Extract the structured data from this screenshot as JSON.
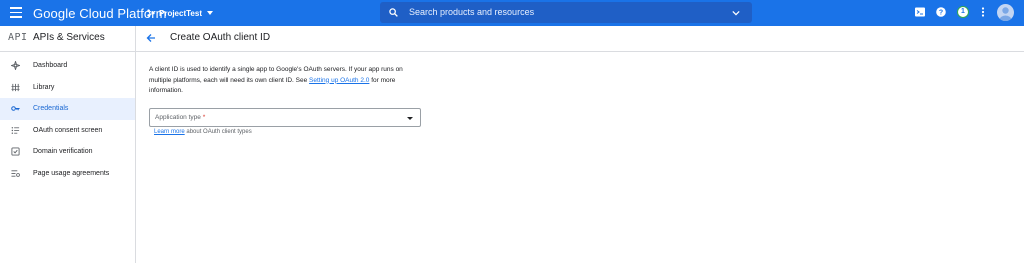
{
  "topbar": {
    "brand": "Google Cloud Platform",
    "project": "ProjectTest",
    "search_placeholder": "Search products and resources",
    "notification_count": "1",
    "color": "#1a73e8"
  },
  "subheader": {
    "api_logo": "API",
    "api_title": "APIs & Services",
    "page_title": "Create OAuth client ID"
  },
  "sidebar": {
    "items": [
      {
        "label": "Dashboard",
        "icon": "dashboard-icon"
      },
      {
        "label": "Library",
        "icon": "library-icon"
      },
      {
        "label": "Credentials",
        "icon": "key-icon"
      },
      {
        "label": "OAuth consent screen",
        "icon": "consent-icon"
      },
      {
        "label": "Domain verification",
        "icon": "checkbox-icon"
      },
      {
        "label": "Page usage agreements",
        "icon": "settings-list-icon"
      }
    ],
    "active_index": 2
  },
  "content": {
    "desc_prefix": "A client ID is used to identify a single app to Google's OAuth servers. If your app runs on multiple platforms, each will need its own client ID. See ",
    "desc_link": "Setting up OAuth 2.0",
    "desc_suffix": " for more information.",
    "select_label": "Application type",
    "select_required_mark": "*",
    "helper_link": "Learn more",
    "helper_suffix": " about OAuth client types"
  }
}
